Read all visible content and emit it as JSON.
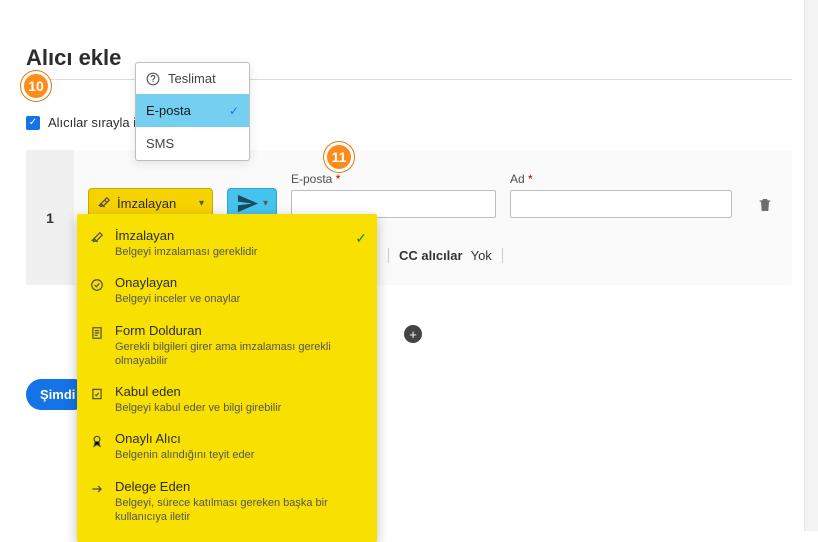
{
  "title": "Alıcı ekle",
  "checkbox_label": "Alıcılar sırayla im",
  "annotations": {
    "a10": "10",
    "a11": "11"
  },
  "delivery": {
    "header": "Teslimat",
    "items": [
      {
        "label": "E-posta",
        "selected": true
      },
      {
        "label": "SMS",
        "selected": false
      }
    ]
  },
  "recipient": {
    "index": "1",
    "role_selected": "İmzalayan",
    "email_label": "E-posta",
    "name_label": "Ad",
    "email_value": "",
    "name_value": ""
  },
  "cc": {
    "label": "CC alıcılar",
    "value": "Yok"
  },
  "submit_label": "Şimdi",
  "roles": [
    {
      "title": "İmzalayan",
      "desc": "Belgeyi imzalaması gereklidir",
      "selected": true
    },
    {
      "title": "Onaylayan",
      "desc": "Belgeyi inceler ve onaylar",
      "selected": false
    },
    {
      "title": "Form Dolduran",
      "desc": "Gerekli bilgileri girer ama imzalaması gerekli olmayabilir",
      "selected": false
    },
    {
      "title": "Kabul eden",
      "desc": "Belgeyi kabul eder ve bilgi girebilir",
      "selected": false
    },
    {
      "title": "Onaylı Alıcı",
      "desc": "Belgenin alındığını teyit eder",
      "selected": false
    },
    {
      "title": "Delege Eden",
      "desc": "Belgeyi, sürece katılması gereken başka bir kullanıcıya iletir",
      "selected": false
    }
  ]
}
